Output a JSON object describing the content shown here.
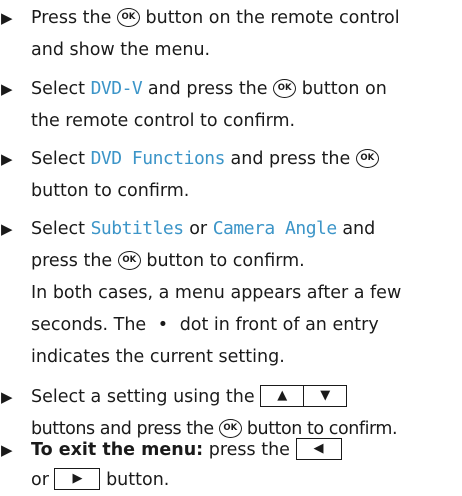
{
  "steps": [
    {
      "line1": {
        "a": "Press the",
        "b": "button on the remote control"
      },
      "line2": "and show the menu."
    },
    {
      "line1": {
        "a": "Select",
        "ui": "DVD-V",
        "b": "and press the",
        "c": "button on"
      },
      "line2": "the remote control to confirm."
    },
    {
      "line1": {
        "a": "Select",
        "ui": "DVD Functions",
        "b": "and press the"
      },
      "line2": "button to confirm."
    },
    {
      "line1": {
        "a": "Select",
        "ui1": "Subtitles",
        "or": "or",
        "ui2": "Camera Angle",
        "b": "and"
      },
      "line2": {
        "a": "press the",
        "b": "button to confirm."
      },
      "line3": "In both cases, a menu appears after a few",
      "line4": {
        "a": "seconds. The",
        "dot": "•",
        "b": "dot in front of an entry"
      },
      "line5": "indicates the current setting."
    },
    {
      "line1": {
        "a": "Select a setting using the"
      },
      "line2": {
        "a": "buttons and press the",
        "b": "button to confirm."
      }
    },
    {
      "line1": {
        "bold": "To exit the menu:",
        "a": "press the"
      },
      "line2": {
        "a": "or",
        "b": "button."
      }
    }
  ],
  "icons": {
    "bullet": "▶",
    "ok_button": "OK",
    "up_arrow": "▲",
    "down_arrow": "▼",
    "left_arrow": "◀",
    "right_arrow": "▶"
  },
  "colors": {
    "text": "#1a1a1a",
    "ui_term": "#3c95c8"
  }
}
